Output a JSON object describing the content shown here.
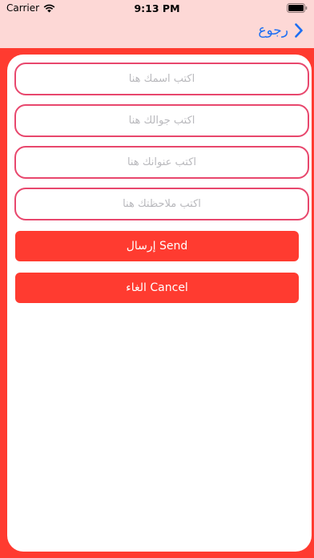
{
  "status_bar": {
    "carrier": "Carrier",
    "time": "9:13 PM"
  },
  "nav": {
    "back_label": "رجوع",
    "accent_color": "#1b6ef3"
  },
  "form": {
    "fields": [
      {
        "placeholder": "اكتب اسمك هنا",
        "value": ""
      },
      {
        "placeholder": "اكتب جوالك هنا",
        "value": ""
      },
      {
        "placeholder": "اكتب عنوانك هنا",
        "value": ""
      },
      {
        "placeholder": "اكتب ملاحظتك هنا",
        "value": ""
      }
    ],
    "send_label": "إرسال Send",
    "cancel_label": "الغاء Cancel"
  },
  "theme": {
    "primary": "#ff3b30",
    "header_bg": "#fdd8d6",
    "field_border": "#e8476d"
  }
}
